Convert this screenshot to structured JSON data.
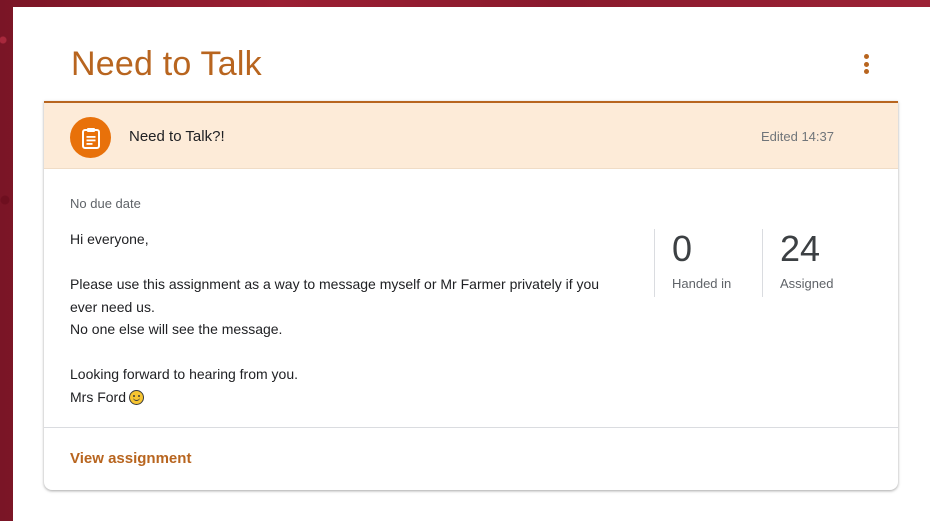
{
  "topic": {
    "title": "Need to Talk",
    "more_icon": "more-vert-icon"
  },
  "assignment": {
    "icon": "assignment-icon",
    "title": "Need to Talk?!",
    "edited": "Edited 14:37",
    "due": "No due date",
    "body": {
      "greeting": "Hi everyone,",
      "para1_line1": "Please use this assignment as a way to message myself or Mr Farmer privately if you",
      "para1_line2": "ever need us.",
      "para1_line3": "No one else will see the message.",
      "para2_line1": "Looking forward to hearing from you.",
      "signature": "Mrs Ford",
      "signature_emoji": "smiley-emoji-icon"
    },
    "stats": {
      "handed_in_count": "0",
      "handed_in_label": "Handed in",
      "assigned_count": "24",
      "assigned_label": "Assigned"
    },
    "view_link": "View assignment"
  },
  "colors": {
    "accent": "#b8651f",
    "icon_bg": "#e8710a",
    "header_bg": "#fdebd8",
    "backdrop": "#8d1a2c"
  }
}
